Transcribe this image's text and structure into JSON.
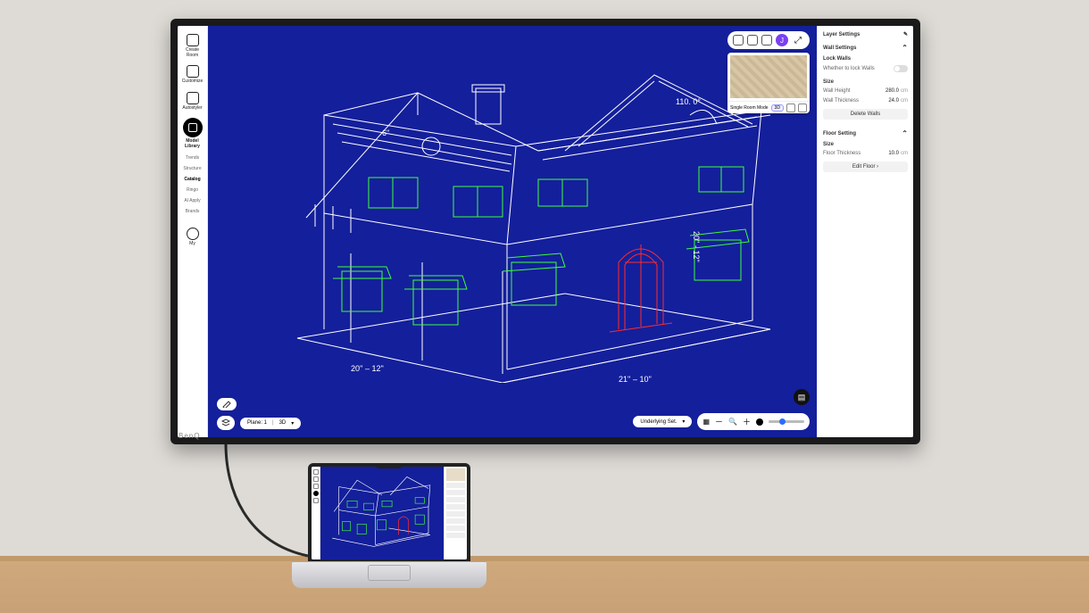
{
  "sidebar": {
    "items": [
      {
        "id": "create-room",
        "label": "Create Room"
      },
      {
        "id": "customize",
        "label": "Customize"
      },
      {
        "id": "autostyler",
        "label": "Autostyler"
      },
      {
        "id": "model-library",
        "label": "Model Library"
      }
    ],
    "subitems": [
      {
        "id": "trends",
        "label": "Trends"
      },
      {
        "id": "structure",
        "label": "Structure"
      },
      {
        "id": "catalog",
        "label": "Catalog"
      },
      {
        "id": "ringo",
        "label": "Ringo"
      },
      {
        "id": "ai-apply",
        "label": "AI Apply"
      },
      {
        "id": "brands",
        "label": "Brands"
      }
    ],
    "my": {
      "label": "My"
    }
  },
  "header": {
    "avatar_initial": "J"
  },
  "minimap": {
    "mode_label": "Single Room Mode",
    "view_label": "3D"
  },
  "rpanel": {
    "layer_title": "Layer Settings",
    "wall_title": "Wall Settings",
    "lock_label": "Lock Walls",
    "lock_hint": "Whether to lock Walls",
    "size_label": "Size",
    "wall_height_label": "Wall Height",
    "wall_height_value": "280.0",
    "wall_thick_label": "Wall Thickness",
    "wall_thick_value": "24.0",
    "unit": "cm",
    "delete_walls": "Delete Walls",
    "floor_title": "Floor Setting",
    "floor_size": "Size",
    "floor_thick_label": "Floor Thickness",
    "floor_thick_value": "10.0",
    "edit_floor": "Edit Floor ›"
  },
  "bottombar": {
    "plane_label": "Plane: 1",
    "view3d": "3D",
    "underlying": "Underlying Set."
  },
  "canvas": {
    "angle": "110. 0°",
    "dim_right": "20'' - 12''",
    "dim_front": "21'' – 10''",
    "dim_left": "20'' – 12''",
    "dim_side": "6''"
  },
  "monitor_brand": "BenQ"
}
